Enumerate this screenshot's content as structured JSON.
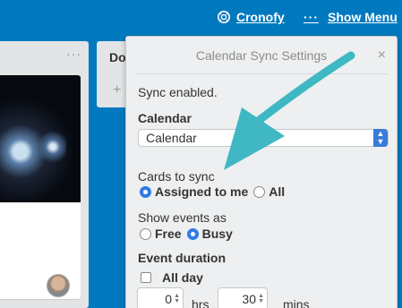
{
  "header": {
    "cronofy_label": "Cronofy",
    "dots": "···",
    "show_menu_label": "Show Menu"
  },
  "lists": {
    "left": {
      "dots": "···"
    },
    "mid": {
      "title": "Do",
      "add": "+"
    }
  },
  "popover": {
    "title": "Calendar Sync Settings",
    "close": "×",
    "status": "Sync enabled.",
    "calendar_label": "Calendar",
    "calendar_selected": "Calendar",
    "cards_to_sync_label": "Cards to sync",
    "cards_options": [
      "Assigned to me",
      "All"
    ],
    "cards_selected": "Assigned to me",
    "show_events_label": "Show events as",
    "show_options": [
      "Free",
      "Busy"
    ],
    "show_selected": "Busy",
    "event_duration_label": "Event duration",
    "all_day_label": "All day",
    "all_day_checked": false,
    "hours_value": "0",
    "hours_unit": "hrs",
    "mins_value": "30",
    "mins_unit": "mins"
  },
  "colors": {
    "board_bg": "#0079bf",
    "accent": "#2f7ae5",
    "arrow": "#3fb8c4"
  }
}
